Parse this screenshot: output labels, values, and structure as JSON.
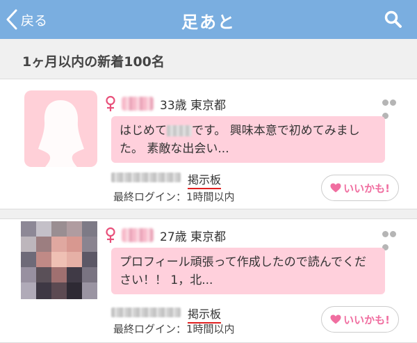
{
  "header": {
    "back_label": "戻る",
    "title": "足あと"
  },
  "subheader": {
    "text": "1ヶ月以内の新着100名"
  },
  "colors": {
    "header_bg": "#7aaee0",
    "bubble_bg": "#ffd0dc",
    "accent_pink": "#f06ea0",
    "female_icon": "#e8507a",
    "board_underline": "#e02020"
  },
  "footprints": [
    {
      "age_location": "33歳 東京都",
      "message_before": "はじめて",
      "message_after": "です。 興味本意で初めてみました。 素敵な出会い...",
      "board_label": "掲示板",
      "last_login": "最終ログイン：1時間以内",
      "like_label": "いいかも!",
      "avatar": "silhouette"
    },
    {
      "age_location": "27歳 東京都",
      "message_before": "",
      "message_after": "プロフィール頑張って作成したので読んでください！！ 1，北...",
      "board_label": "掲示板",
      "last_login": "最終ログイン：1時間以内",
      "like_label": "いいかも!",
      "avatar": "photo"
    }
  ],
  "icons": {
    "back": "chevron-left-icon",
    "search": "search-icon",
    "gender": "female-icon",
    "more": "more-dots-icon",
    "like": "heart-icon"
  }
}
